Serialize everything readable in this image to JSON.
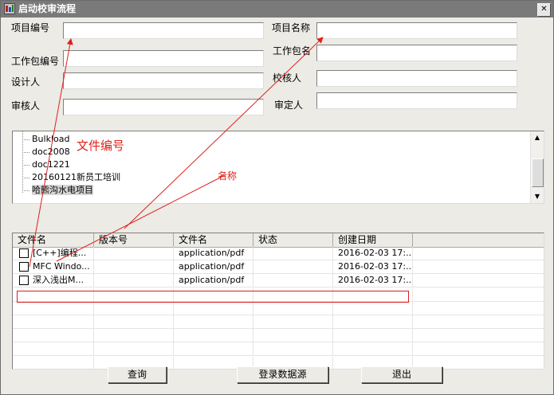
{
  "window": {
    "title": "启动校审流程",
    "close_glyph": "✕"
  },
  "form": {
    "project_no_label": "项目编号",
    "project_name_label": "项目名称",
    "package_no_label": "工作包编号",
    "package_name_label": "工作包名",
    "designer_label": "设计人",
    "checker_label": "校核人",
    "reviewer_label": "审核人",
    "approver_label": "审定人",
    "project_no": "",
    "project_name": "",
    "package_no": "",
    "package_name": "",
    "designer": "",
    "checker": "",
    "reviewer": "",
    "approver": ""
  },
  "tree": {
    "items": [
      "Bulkload",
      "doc2008",
      "doc1221",
      "20160121新员工培训",
      "哈熊沟水电项目"
    ],
    "selected_index": 4
  },
  "annotations": {
    "file_no": "文件编号",
    "name": "名称"
  },
  "table": {
    "columns": [
      "文件名",
      "版本号",
      "文件名",
      "状态",
      "创建日期"
    ],
    "rows": [
      {
        "name": "[C++]编程...",
        "version": "",
        "type": "application/pdf",
        "status": "",
        "date": "2016-02-03 17:..."
      },
      {
        "name": "MFC Windo...",
        "version": "",
        "type": "application/pdf",
        "status": "",
        "date": "2016-02-03 17:..."
      },
      {
        "name": "深入浅出M...",
        "version": "",
        "type": "application/pdf",
        "status": "",
        "date": "2016-02-03 17:..."
      }
    ],
    "highlighted_row": 2
  },
  "buttons": {
    "query": "查询",
    "login": "登录数据源",
    "exit": "退出"
  },
  "colors": {
    "annotation": "#e0201a",
    "titlebar": "#7a7a7a"
  }
}
